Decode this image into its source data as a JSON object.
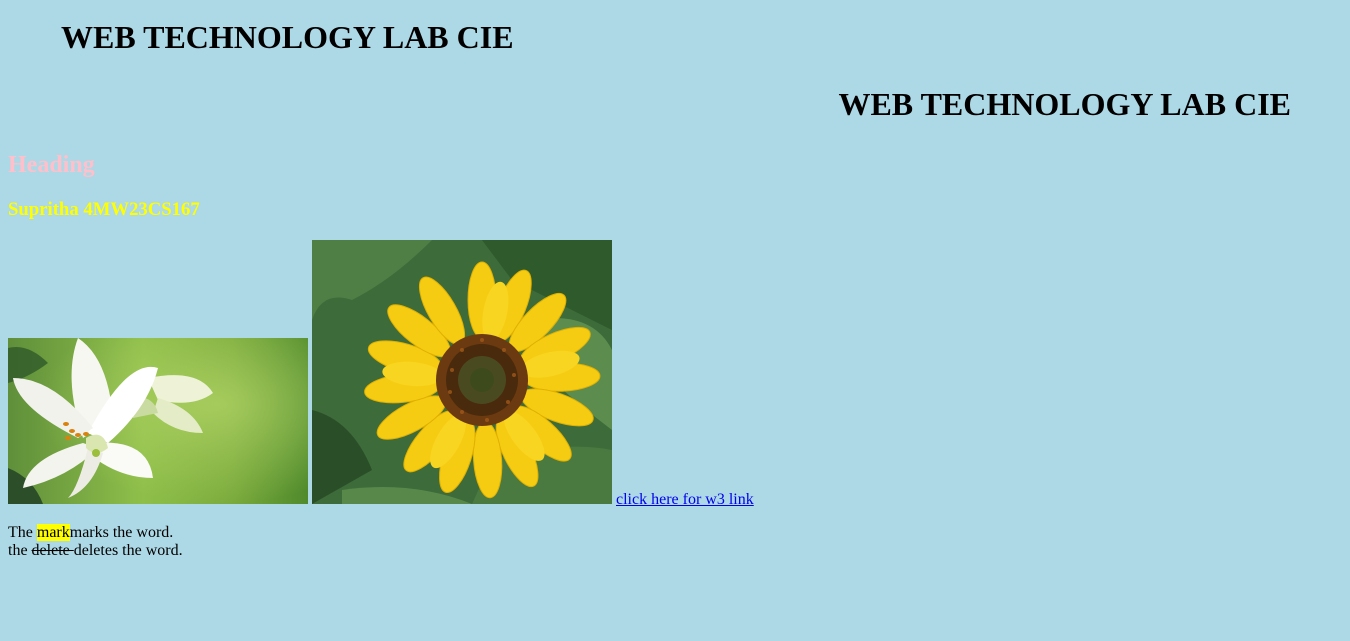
{
  "page": {
    "title_left": "WEB TECHNOLOGY LAB CIE",
    "title_right": "WEB TECHNOLOGY LAB CIE",
    "heading": "Heading",
    "subheading": "Supritha 4MW23CS167",
    "link_text": "click here for w3 link",
    "mark_line": {
      "prefix": "The ",
      "marked": "mark",
      "suffix": "marks the word."
    },
    "delete_line": {
      "prefix": "the ",
      "deleted": "delete ",
      "suffix": "deletes the word."
    }
  },
  "images": [
    {
      "name": "lily-image",
      "subject": "white lily flower"
    },
    {
      "name": "sunflower-image",
      "subject": "yellow sunflower"
    }
  ],
  "colors": {
    "background": "#add8e6",
    "heading": "#ffc0cb",
    "subheading": "#ffff00",
    "link": "#0000ee",
    "mark_highlight": "#ffff00"
  }
}
